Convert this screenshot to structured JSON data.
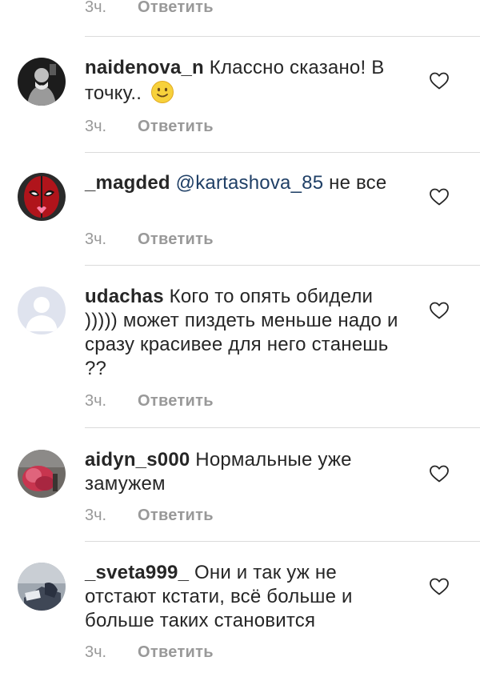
{
  "top": {
    "time": "3ч.",
    "reply": "Ответить"
  },
  "comments": [
    {
      "username": "naidenova_n",
      "text_before": "Классно сказано! В точку..",
      "mention": "",
      "text_after": "",
      "has_emoji": true,
      "emoji": "slightly-smiling-face",
      "time": "3ч.",
      "reply": "Ответить",
      "avatar": "photo-person-dark"
    },
    {
      "username": "_magded",
      "text_before": "",
      "mention": "@kartashova_85",
      "text_after": "не все",
      "has_emoji": false,
      "time": "3ч.",
      "reply": "Ответить",
      "avatar": "deadpool-mask"
    },
    {
      "username": "udachas",
      "text_before": "Кого то опять обидели ))))) может пиздеть меньше надо и сразу красивее для него станешь ??",
      "mention": "",
      "text_after": "",
      "has_emoji": false,
      "time": "3ч.",
      "reply": "Ответить",
      "avatar": "default-user"
    },
    {
      "username": "aidyn_s000",
      "text_before": "Нормальные уже замужем",
      "mention": "",
      "text_after": "",
      "has_emoji": false,
      "time": "3ч.",
      "reply": "Ответить",
      "avatar": "photo-red-smoke"
    },
    {
      "username": "_sveta999_",
      "text_before": "Они и так уж не отстают кстати, всё больше и больше таких становится",
      "mention": "",
      "text_after": "",
      "has_emoji": false,
      "time": "3ч.",
      "reply": "Ответить",
      "avatar": "photo-laptop-room"
    }
  ],
  "colors": {
    "text": "#262626",
    "meta": "#999999",
    "mention": "#1f3f66",
    "divider": "#dbdbdb"
  }
}
